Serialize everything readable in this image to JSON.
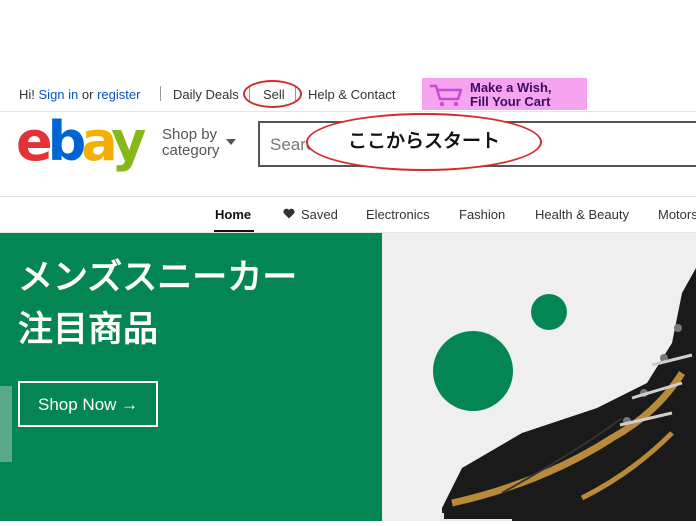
{
  "topbar": {
    "greeting": "Hi!",
    "sign_in": "Sign in",
    "or": "or",
    "register": "register",
    "daily_deals": "Daily Deals",
    "sell": "Sell",
    "help_contact": "Help & Contact"
  },
  "promo": {
    "line1": "Make a Wish,",
    "line2": "Fill Your Cart"
  },
  "header": {
    "logo_letters": [
      "e",
      "b",
      "a",
      "y"
    ],
    "logo_colors": [
      "#e53238",
      "#0064d2",
      "#f5af02",
      "#86b817"
    ],
    "shop_by_line1": "Shop by",
    "shop_by_line2": "category",
    "search_placeholder": "Search"
  },
  "annotation": {
    "text": "ここからスタート",
    "color": "#d32b2b"
  },
  "nav": {
    "home": "Home",
    "saved": "Saved",
    "electronics": "Electronics",
    "fashion": "Fashion",
    "health_beauty": "Health & Beauty",
    "motors": "Motors"
  },
  "hero": {
    "title_line1": "メンズスニーカー",
    "title_line2": "注目商品",
    "cta": "Shop Now →",
    "background": "#048554"
  }
}
